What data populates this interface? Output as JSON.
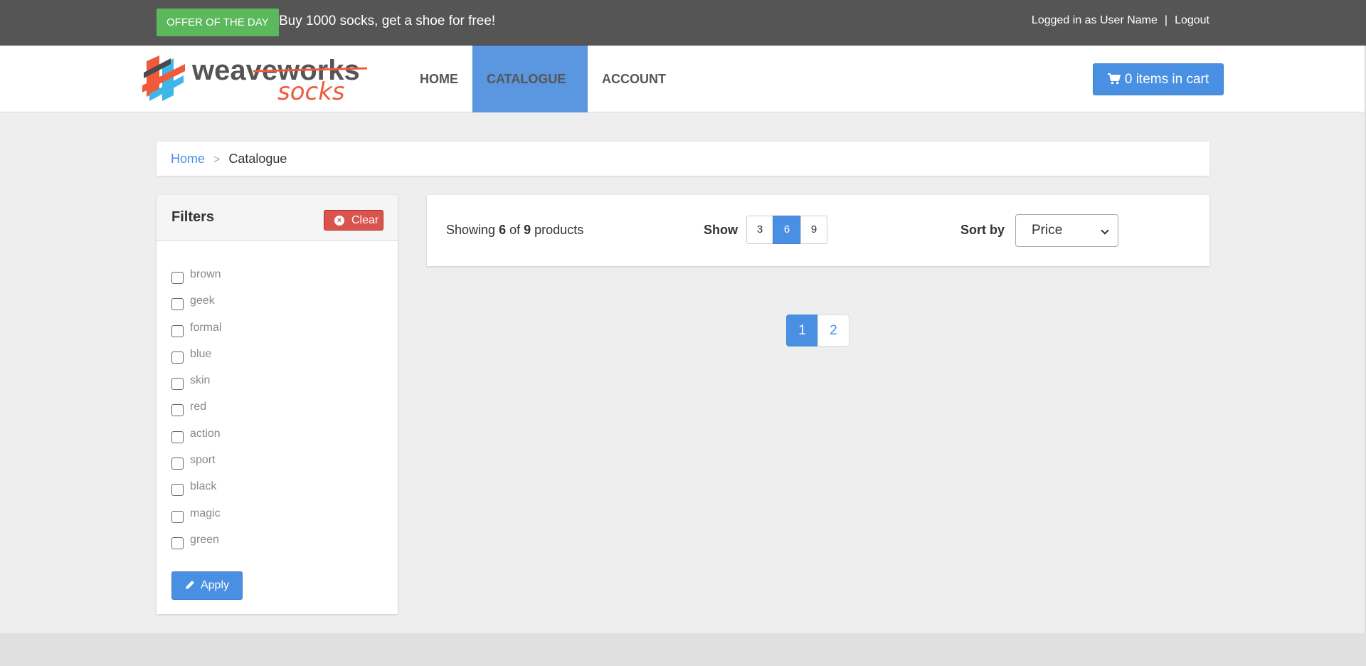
{
  "topbar": {
    "offer_badge": "OFFER OF THE DAY",
    "offer_text": "Buy 1000 socks, get a shoe for free!",
    "logged_in_text": "Logged in as User Name",
    "separator": "|",
    "logout": "Logout"
  },
  "brand": {
    "logo_primary": "weaveworks",
    "logo_secondary": "socks",
    "colors": {
      "accent_blue": "#4a90e2",
      "logo_orange": "#f05a3a",
      "logo_blue": "#3eb6e8"
    }
  },
  "nav": {
    "home": "HOME",
    "catalogue": "CATALOGUE",
    "account": "ACCOUNT",
    "cart": "0 items in cart",
    "cart_icon": "cart-icon"
  },
  "breadcrumb": {
    "home": "Home",
    "separator": ">",
    "current": "Catalogue"
  },
  "filters": {
    "title": "Filters",
    "clear": "Clear",
    "apply": "Apply",
    "items": [
      {
        "label": "brown"
      },
      {
        "label": "geek"
      },
      {
        "label": "formal"
      },
      {
        "label": "blue"
      },
      {
        "label": "skin"
      },
      {
        "label": "red"
      },
      {
        "label": "action"
      },
      {
        "label": "sport"
      },
      {
        "label": "black"
      },
      {
        "label": "magic"
      },
      {
        "label": "green"
      }
    ]
  },
  "products_bar": {
    "showing_prefix": "Showing",
    "showing_count": "6",
    "showing_of": "of",
    "showing_total": "9",
    "showing_suffix": "products",
    "show_label": "Show",
    "page_sizes": [
      "3",
      "6",
      "9"
    ],
    "selected_page_size": "6",
    "sort_label": "Sort by",
    "sort_value": "Price"
  },
  "pagination": {
    "pages": [
      "1",
      "2"
    ],
    "current": "1"
  }
}
